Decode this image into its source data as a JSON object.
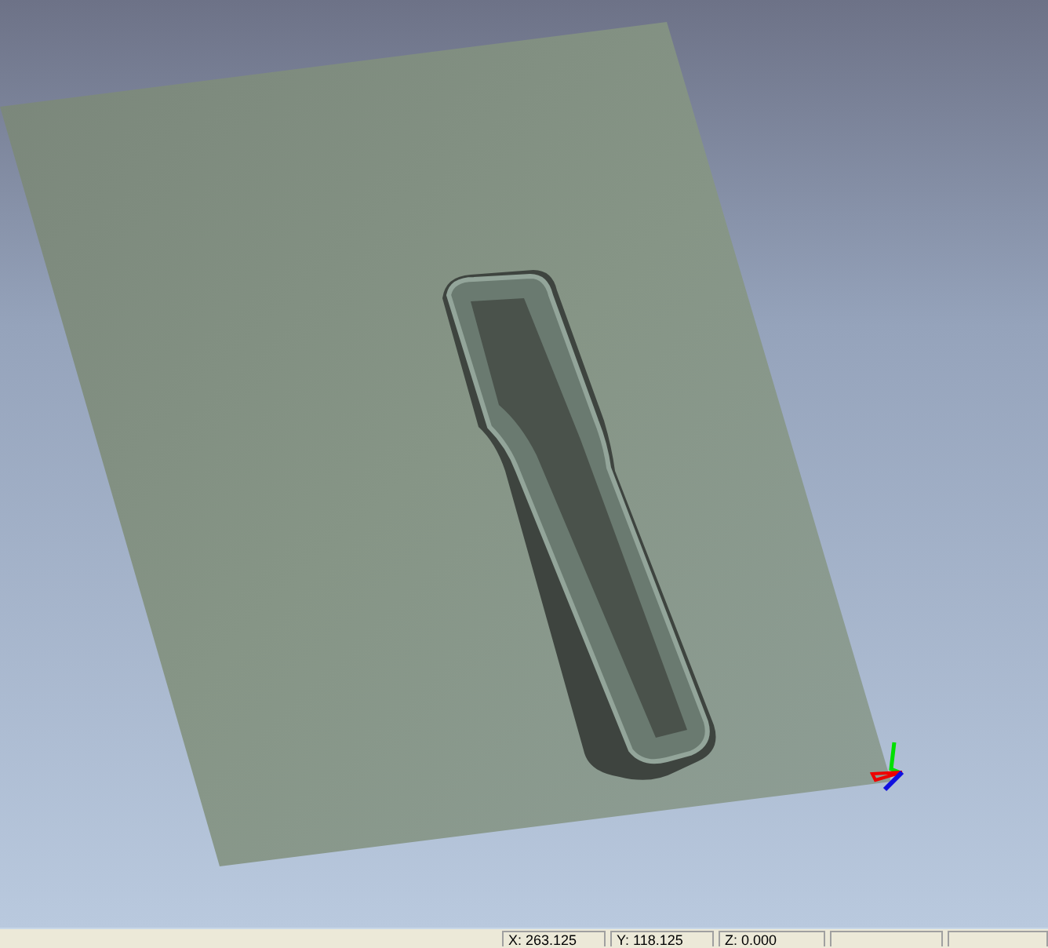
{
  "status_bar": {
    "fields": [
      "X: 263.125",
      "Y: 118.125",
      "Z: 0.000"
    ]
  }
}
